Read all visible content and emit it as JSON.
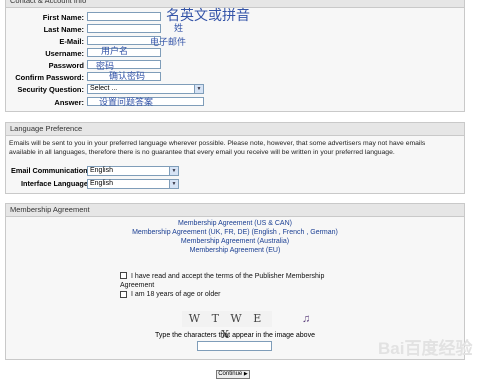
{
  "contact": {
    "title": "Contact & Account Info",
    "fields": [
      {
        "label": "First Name:",
        "note": "名英文或拼音"
      },
      {
        "label": "Last Name:",
        "note": "姓"
      },
      {
        "label": "E-Mail:",
        "note": "电子邮件"
      },
      {
        "label": "Username:",
        "note": "用户名"
      },
      {
        "label": "Password",
        "note": "密码"
      },
      {
        "label": "Confirm Password:",
        "note": "确认密码"
      },
      {
        "label": "Security Question:",
        "value": "Select ..."
      },
      {
        "label": "Answer:",
        "note": "设置问题答案"
      }
    ]
  },
  "language": {
    "title": "Language Preference",
    "desc": "Emails will be sent to you in your preferred language wherever possible. Please note, however, that some advertisers may not have emails available in all languages, therefore there is no guarantee that every email you receive will be written in your preferred language.",
    "email_label": "Email Communications",
    "email_value": "English",
    "interface_label": "Interface Language",
    "interface_value": "English"
  },
  "membership": {
    "title": "Membership Agreement",
    "links": [
      "Membership Agreement (US & CAN)",
      "Membership Agreement (UK, FR, DE) (English , French , German)",
      "Membership Agreement (Australia)",
      "Membership Agreement (EU)"
    ],
    "accept_text": "I have read and accept the terms of the Publisher Membership Agreement",
    "age_text": "I am 18 years of age or older",
    "captcha_text": "W T W E X",
    "captcha_prompt": "Type the characters that appear in the image above",
    "watermark": "Bai百度经验"
  },
  "continue_label": "Continue"
}
